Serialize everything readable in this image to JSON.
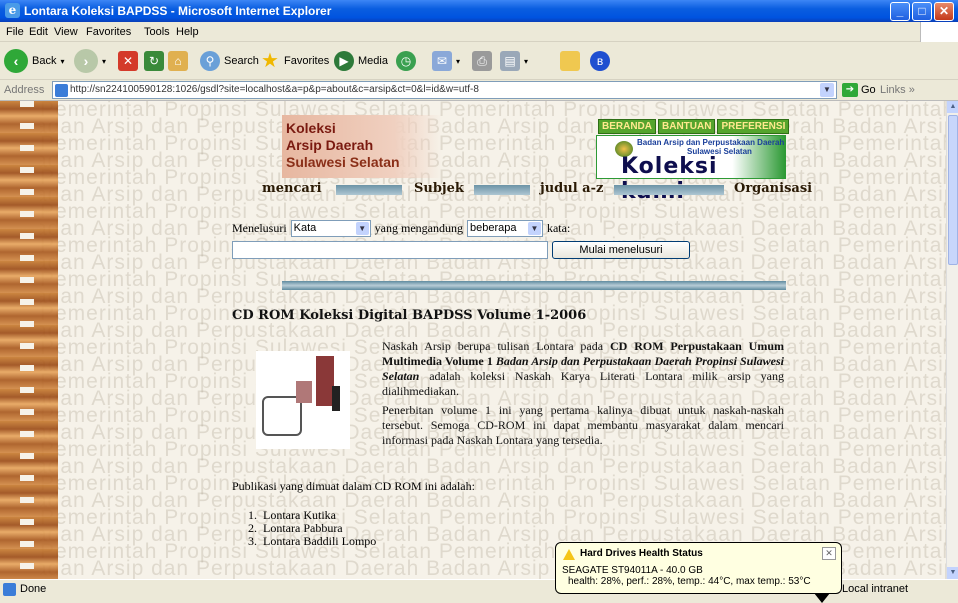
{
  "window": {
    "title": "Lontara Koleksi BAPDSS - Microsoft Internet Explorer"
  },
  "menu": [
    "File",
    "Edit",
    "View",
    "Favorites",
    "Tools",
    "Help"
  ],
  "toolbar": {
    "back": "Back",
    "search": "Search",
    "favorites": "Favorites",
    "media": "Media"
  },
  "address": {
    "label": "Address",
    "url": "http://sn224100590128:1026/gsdl?site=localhost&a=p&p=about&c=arsip&ct=0&l=id&w=utf-8",
    "go": "Go",
    "links": "Links"
  },
  "page": {
    "logo_lines": [
      "Koleksi",
      "Arsip Daerah",
      "Sulawesi Selatan"
    ],
    "nav_buttons": [
      "BERANDA",
      "BANTUAN",
      "PREFERENSI"
    ],
    "logo2_small1": "Badan Arsip dan Perpustakaan Daerah",
    "logo2_small2": "Sulawesi Selatan",
    "logo2_big": "Koleksi kami",
    "nav_links": [
      "mencari",
      "Subjek",
      "judul a-z",
      "Organisasi"
    ],
    "search": {
      "label1": "Menelusuri",
      "select1": "Kata",
      "label2": "yang mengandung",
      "select2": "beberapa",
      "label3": "kata:",
      "button": "Mulai menelusuri"
    },
    "heading": "CD ROM Koleksi Digital BAPDSS Volume 1-2006",
    "p1_a": "Naskah Arsip berupa tulisan Lontara pada ",
    "p1_b": "CD ROM Perpustakaan Umum Multimedia Volume 1 ",
    "p1_c": "Badan Arsip dan Perpustakaan Daerah Propinsi Sulawesi Selatan",
    "p1_d": " adalah koleksi Naskah Karya Literati Lontara milik arsip yang dialihmediakan.",
    "p2": "Penerbitan volume 1 ini yang pertama kalinya dibuat untuk naskah-naskah tersebut. Semoga CD-ROM ini dapat membantu masyarakat dalam mencari informasi pada Naskah Lontara yang tersedia.",
    "pub": "Publikasi yang dimuat dalam CD ROM ini adalah:",
    "list": [
      "Lontara Kutika",
      "Lontara Pabbura",
      "Lontara Baddili Lompo"
    ],
    "watermark": [
      "Pemerintah Propinsi Sulawesi Selatan",
      "Badan Arsip dan Perpustakaan Daerah"
    ]
  },
  "status": {
    "done": "Done",
    "zone": "Local intranet"
  },
  "balloon": {
    "title": "Hard Drives Health Status",
    "line1": "SEAGATE ST94011A - 40.0 GB",
    "line2": "health: 28%, perf.: 28%, temp.: 44°C, max temp.: 53°C"
  }
}
